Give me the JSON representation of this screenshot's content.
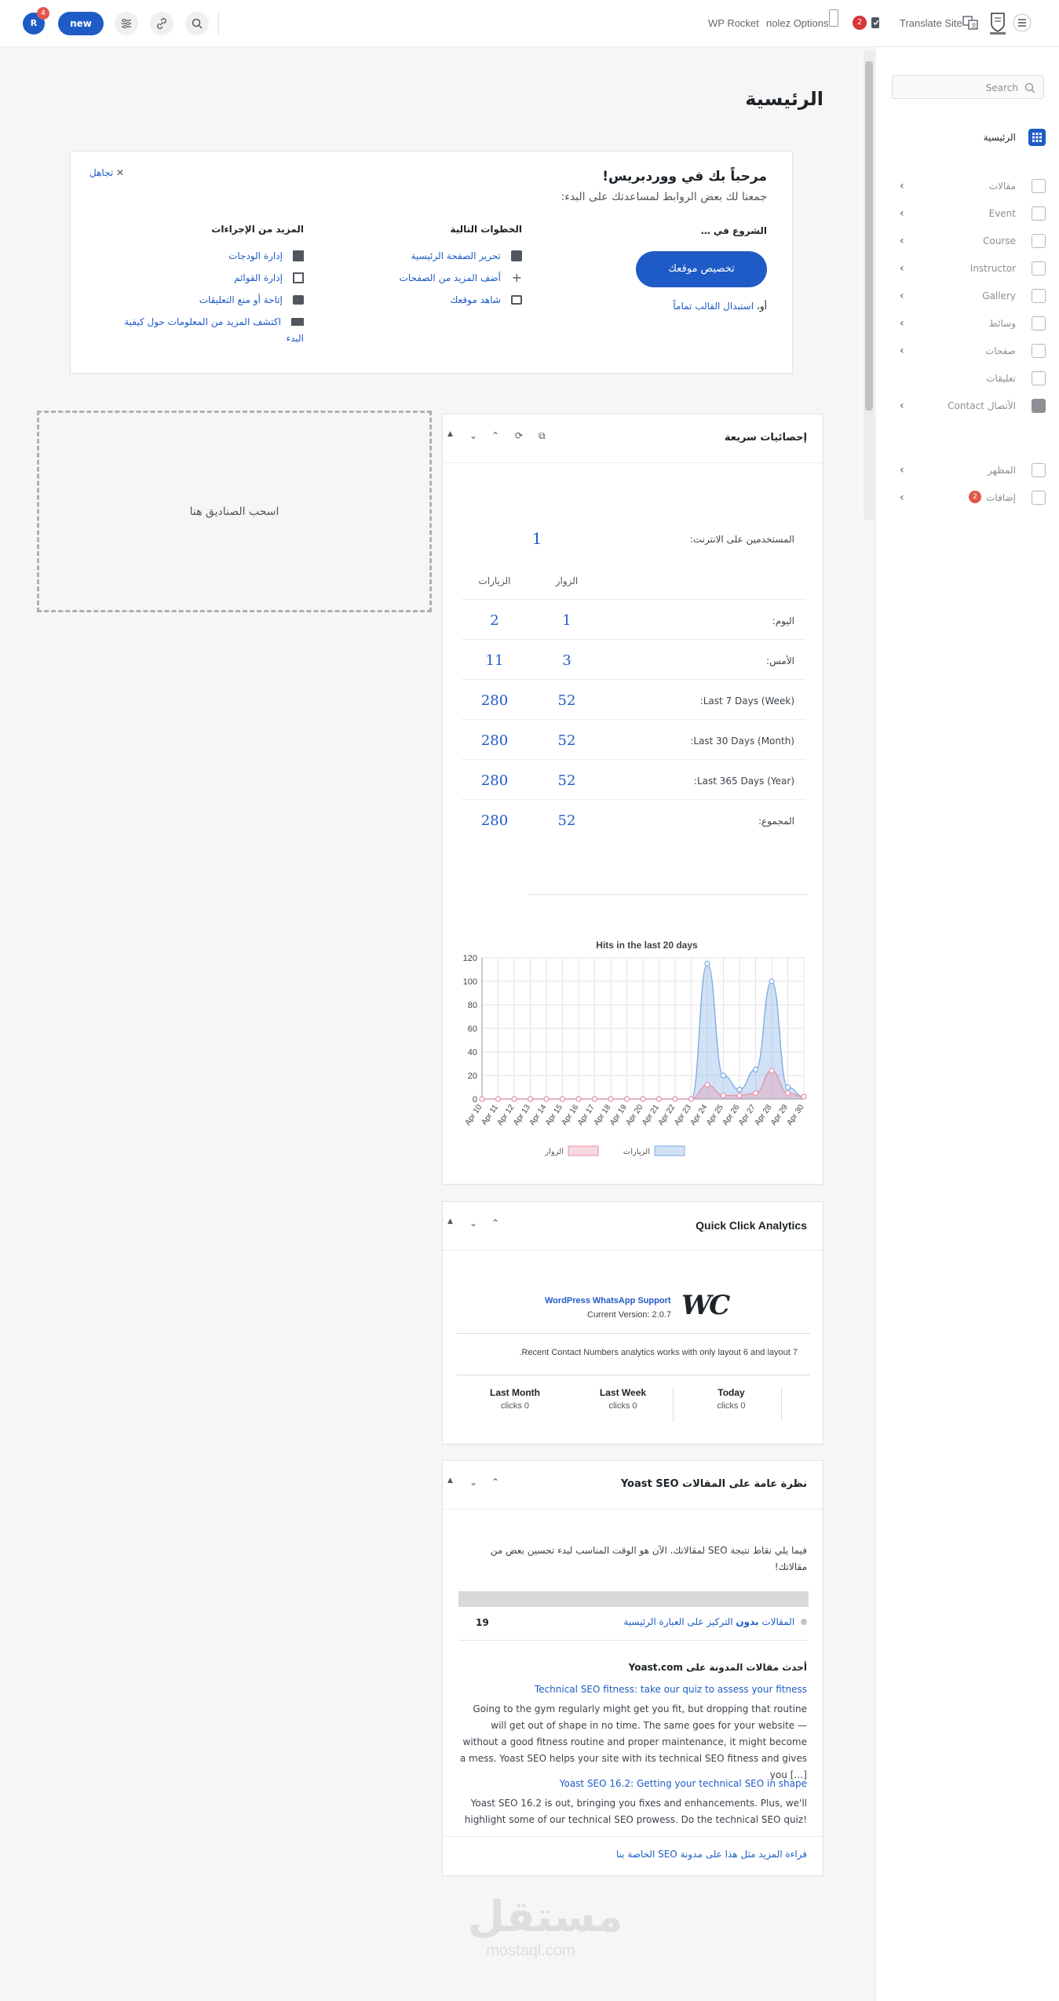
{
  "topbar": {
    "avatar_letter": "R",
    "avatar_badge": "4",
    "new_label": "new",
    "wp_rocket": "WP Rocket",
    "theme_options": "nolez Options",
    "updates_badge": "2",
    "translate_label": "Translate Site"
  },
  "page": {
    "title": "الرئيسية"
  },
  "sidebar": {
    "search_placeholder": "Search",
    "home_label": "الرئيسية",
    "items": [
      {
        "label": "مقالات",
        "chev": "‹"
      },
      {
        "label": "Event",
        "chev": "‹"
      },
      {
        "label": "Course",
        "chev": "‹"
      },
      {
        "label": "Instructor",
        "chev": "‹"
      },
      {
        "label": "Gallery",
        "chev": "‹"
      },
      {
        "label": "وسائط",
        "chev": "‹"
      },
      {
        "label": "صفحات",
        "chev": "‹"
      },
      {
        "label": "تعليقات",
        "chev": ""
      },
      {
        "label": "Contact الأتصال",
        "chev": "‹"
      },
      {
        "label": "المظهر",
        "chev": "‹"
      },
      {
        "label": "إضافات",
        "chev": "‹"
      }
    ],
    "plugins_badge": "2"
  },
  "welcome": {
    "dismiss": "تجاهل",
    "heading": "مرحباً بك في ووردبريس!",
    "subheading": "جمعنا لك بعض الروابط لمساعدتك على البدء:",
    "col1_title": "الشروع في …",
    "customize_button": "تخصيص موقعك",
    "or_text": "أو،",
    "change_theme_link": "استبدال القالب تماماً",
    "col2_title": "الخطوات التالية",
    "next_steps": [
      "تحرير الصفحة الرئيسية",
      "أضف المزيد من الصفحات",
      "شاهد موقعك"
    ],
    "col3_title": "المزيد من الإجراءات",
    "more_actions": [
      "إدارة الودجات",
      "إدارة القوائم",
      "إتاحة أو منع التعليقات",
      "اكتشف المزيد من المعلومات حول كيفية",
      "البدء"
    ]
  },
  "dropzone": {
    "label": "اسحب الصناديق هنا"
  },
  "quick_stats": {
    "title": "إحصائيات سريعة",
    "online_label": "المستخدمين على الانترنت:",
    "online_value": "1",
    "col_visitors": "الزوار",
    "col_visits": "الزيارات",
    "rows": [
      {
        "label": "اليوم:",
        "visitors": "1",
        "visits": "2"
      },
      {
        "label": "الأمس:",
        "visitors": "3",
        "visits": "11"
      },
      {
        "label": "Last 7 Days (Week):",
        "visitors": "52",
        "visits": "280"
      },
      {
        "label": "Last 30 Days (Month):",
        "visitors": "52",
        "visits": "280"
      },
      {
        "label": "Last 365 Days (Year):",
        "visitors": "52",
        "visits": "280"
      },
      {
        "label": "المجموع:",
        "visitors": "52",
        "visits": "280"
      }
    ]
  },
  "chart_data": {
    "type": "area",
    "title": "Hits in the last 20 days",
    "categories": [
      "Apr 10",
      "Apr 11",
      "Apr 12",
      "Apr 13",
      "Apr 14",
      "Apr 15",
      "Apr 16",
      "Apr 17",
      "Apr 18",
      "Apr 19",
      "Apr 20",
      "Apr 21",
      "Apr 22",
      "Apr 23",
      "Apr 24",
      "Apr 25",
      "Apr 26",
      "Apr 27",
      "Apr 28",
      "Apr 29",
      "Apr 30"
    ],
    "ylim": [
      0,
      120
    ],
    "yticks": [
      0,
      20,
      40,
      60,
      80,
      100,
      120
    ],
    "grid": true,
    "legend_position": "bottom",
    "series": [
      {
        "name": "الزيارات",
        "color": "#7aa8e4",
        "values": [
          0,
          0,
          0,
          0,
          0,
          0,
          0,
          0,
          0,
          0,
          0,
          0,
          0,
          0,
          115,
          20,
          8,
          25,
          100,
          10,
          2
        ]
      },
      {
        "name": "الزوار",
        "color": "#e891a5",
        "values": [
          0,
          0,
          0,
          0,
          0,
          0,
          0,
          0,
          0,
          0,
          0,
          0,
          0,
          0,
          12,
          3,
          3,
          5,
          24,
          5,
          2
        ]
      }
    ]
  },
  "quick_click": {
    "title": "Quick Click Analytics",
    "plugin_name": "WordPress WhatsApp Support",
    "version": "Current Version: 2.0.7",
    "logo_text": "WC",
    "note": "Recent Contact Numbers analytics works with only layout 6 and layout 7.",
    "periods": [
      {
        "label": "Today",
        "value": "clicks 0"
      },
      {
        "label": "Last Week",
        "value": "clicks 0"
      },
      {
        "label": "Last Month",
        "value": "clicks 0"
      }
    ]
  },
  "yoast": {
    "title": "نظرة عامة على المقالات Yoast SEO",
    "intro": "فيما يلي نقاط نتيجة SEO لمقالاتك. الآن هو الوقت المناسب لبدء تحسين بعض من مقالاتك!",
    "focus_pre": "المقالات",
    "focus_bold": "بدون",
    "focus_post": "التركيز على العبارة الرئيسية",
    "focus_count": "19",
    "latest_heading": "أحدث مقالات المدونة على Yoast.com",
    "posts": [
      {
        "title": "Technical SEO fitness: take our quiz to assess your fitness",
        "excerpt": "Going to the gym regularly might get you fit, but dropping that routine will get out of shape in no time. The same goes for your website — without a good fitness routine and proper maintenance, it might become a mess. Yoast SEO helps your site with its technical SEO fitness and gives you […]"
      },
      {
        "title": "Yoast SEO 16.2: Getting your technical SEO in shape",
        "excerpt": "Yoast SEO 16.2 is out, bringing you fixes and enhancements. Plus, we'll highlight some of our technical SEO prowess. Do the technical SEO quiz!"
      }
    ],
    "read_more": "قراءة المزيد مثل هذا على مدونة SEO الخاصة بنا"
  },
  "watermark": {
    "arabic": "مستقل",
    "latin": "mostaql.com"
  }
}
